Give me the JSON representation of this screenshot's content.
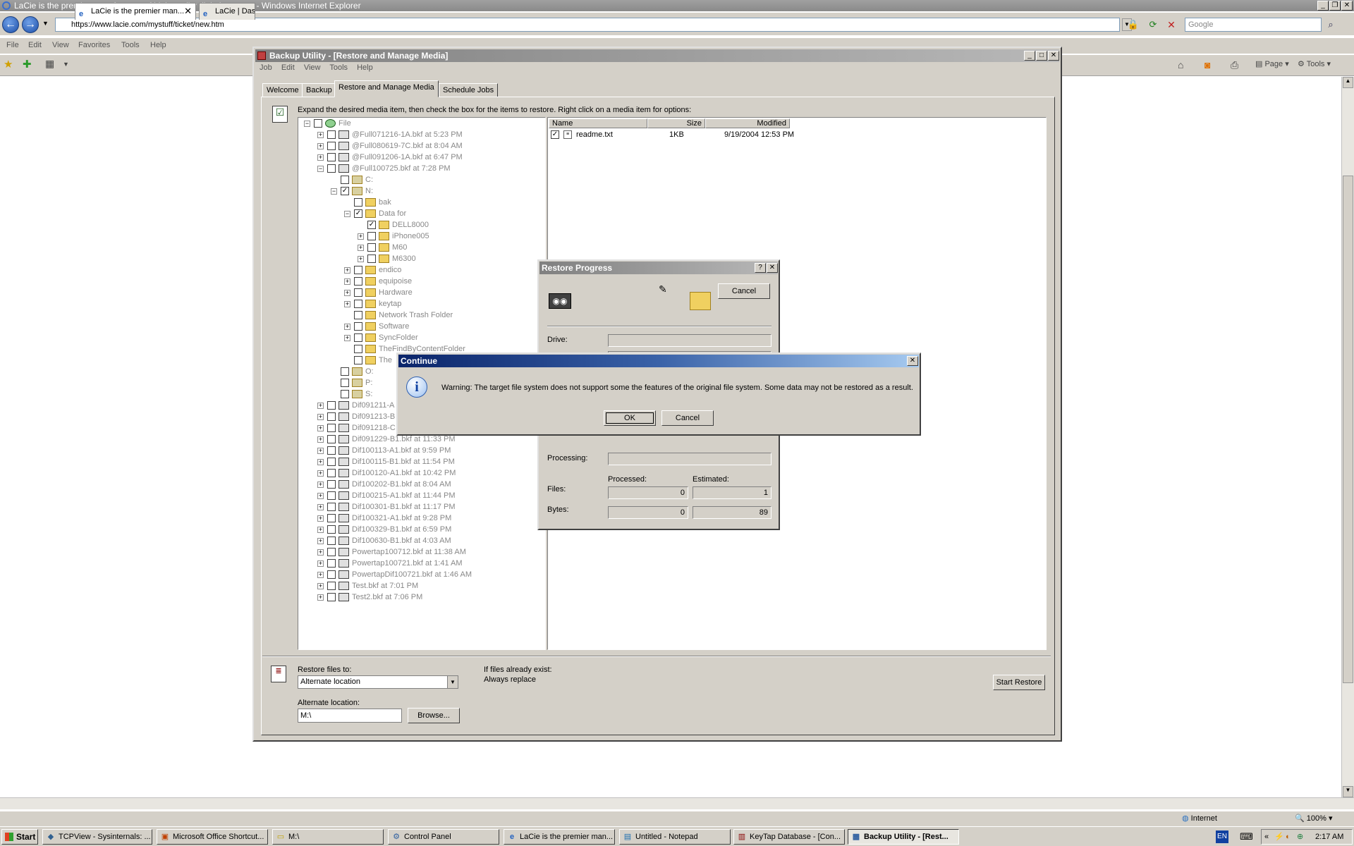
{
  "ie": {
    "title": "LaCie is the premier manufacturer of high quality digital storage. - Windows Internet Explorer",
    "url": "https://www.lacie.com/mystuff/ticket/new.htm",
    "search_placeholder": "Google",
    "menu": [
      "File",
      "Edit",
      "View",
      "Favorites",
      "Tools",
      "Help"
    ],
    "tabs": [
      "LaCie is the premier man...",
      "LaCie | Das"
    ],
    "toolbar": {
      "page": "Page",
      "tools": "Tools"
    },
    "status": {
      "zone": "Internet",
      "zoom": "100%"
    }
  },
  "backup": {
    "title": "Backup Utility - [Restore and Manage Media]",
    "menu": [
      "Job",
      "Edit",
      "View",
      "Tools",
      "Help"
    ],
    "tabs": [
      "Welcome",
      "Backup",
      "Restore and Manage Media",
      "Schedule Jobs"
    ],
    "instruction": "Expand the desired media item, then check the box for the items to restore. Right click on a media item for options:",
    "tree": [
      {
        "label": "File",
        "indent": 0,
        "exp": "-",
        "icon": "file"
      },
      {
        "label": "@Full071216-1A.bkf at 5:23 PM",
        "indent": 1,
        "exp": "+",
        "icon": "tape"
      },
      {
        "label": "@Full080619-7C.bkf at 8:04 AM",
        "indent": 1,
        "exp": "+",
        "icon": "tape"
      },
      {
        "label": "@Full091206-1A.bkf at 6:47 PM",
        "indent": 1,
        "exp": "+",
        "icon": "tape"
      },
      {
        "label": "@Full100725.bkf at 7:28 PM",
        "indent": 1,
        "exp": "-",
        "icon": "tape"
      },
      {
        "label": "C:",
        "indent": 2,
        "exp": "",
        "icon": "drive"
      },
      {
        "label": "N:",
        "indent": 2,
        "exp": "-",
        "icon": "drive",
        "checked": true
      },
      {
        "label": "bak",
        "indent": 3,
        "exp": "",
        "icon": "folder"
      },
      {
        "label": "Data for",
        "indent": 3,
        "exp": "-",
        "icon": "folder",
        "checked": true
      },
      {
        "label": "DELL8000",
        "indent": 4,
        "exp": "",
        "icon": "folder",
        "checked": true
      },
      {
        "label": "iPhone005",
        "indent": 4,
        "exp": "+",
        "icon": "folder"
      },
      {
        "label": "M60",
        "indent": 4,
        "exp": "+",
        "icon": "folder"
      },
      {
        "label": "M6300",
        "indent": 4,
        "exp": "+",
        "icon": "folder"
      },
      {
        "label": "endico",
        "indent": 3,
        "exp": "+",
        "icon": "folder"
      },
      {
        "label": "equipoise",
        "indent": 3,
        "exp": "+",
        "icon": "folder"
      },
      {
        "label": "Hardware",
        "indent": 3,
        "exp": "+",
        "icon": "folder"
      },
      {
        "label": "keytap",
        "indent": 3,
        "exp": "+",
        "icon": "folder"
      },
      {
        "label": "Network Trash Folder",
        "indent": 3,
        "exp": "",
        "icon": "folder"
      },
      {
        "label": "Software",
        "indent": 3,
        "exp": "+",
        "icon": "folder"
      },
      {
        "label": "SyncFolder",
        "indent": 3,
        "exp": "+",
        "icon": "folder"
      },
      {
        "label": "TheFindByContentFolder",
        "indent": 3,
        "exp": "",
        "icon": "folder"
      },
      {
        "label": "The",
        "indent": 3,
        "exp": "",
        "icon": "folder"
      },
      {
        "label": "O:",
        "indent": 2,
        "exp": "",
        "icon": "drive"
      },
      {
        "label": "P:",
        "indent": 2,
        "exp": "",
        "icon": "drive"
      },
      {
        "label": "S:",
        "indent": 2,
        "exp": "",
        "icon": "drive"
      },
      {
        "label": "Dif091211-A",
        "indent": 1,
        "exp": "+",
        "icon": "tape"
      },
      {
        "label": "Dif091213-B",
        "indent": 1,
        "exp": "+",
        "icon": "tape"
      },
      {
        "label": "Dif091218-C",
        "indent": 1,
        "exp": "+",
        "icon": "tape"
      },
      {
        "label": "Dif091229-B1.bkf at 11:33 PM",
        "indent": 1,
        "exp": "+",
        "icon": "tape"
      },
      {
        "label": "Dif100113-A1.bkf at 9:59 PM",
        "indent": 1,
        "exp": "+",
        "icon": "tape"
      },
      {
        "label": "Dif100115-B1.bkf at 11:54 PM",
        "indent": 1,
        "exp": "+",
        "icon": "tape"
      },
      {
        "label": "Dif100120-A1.bkf at 10:42 PM",
        "indent": 1,
        "exp": "+",
        "icon": "tape"
      },
      {
        "label": "Dif100202-B1.bkf at 8:04 AM",
        "indent": 1,
        "exp": "+",
        "icon": "tape"
      },
      {
        "label": "Dif100215-A1.bkf at 11:44 PM",
        "indent": 1,
        "exp": "+",
        "icon": "tape"
      },
      {
        "label": "Dif100301-B1.bkf at 11:17 PM",
        "indent": 1,
        "exp": "+",
        "icon": "tape"
      },
      {
        "label": "Dif100321-A1.bkf at 9:28 PM",
        "indent": 1,
        "exp": "+",
        "icon": "tape"
      },
      {
        "label": "Dif100329-B1.bkf at 6:59 PM",
        "indent": 1,
        "exp": "+",
        "icon": "tape"
      },
      {
        "label": "Dif100630-B1.bkf at 4:03 AM",
        "indent": 1,
        "exp": "+",
        "icon": "tape"
      },
      {
        "label": "Powertap100712.bkf at 11:38 AM",
        "indent": 1,
        "exp": "+",
        "icon": "tape"
      },
      {
        "label": "Powertap100721.bkf at 1:41 AM",
        "indent": 1,
        "exp": "+",
        "icon": "tape"
      },
      {
        "label": "PowertapDif100721.bkf at 1:46 AM",
        "indent": 1,
        "exp": "+",
        "icon": "tape"
      },
      {
        "label": "Test.bkf at 7:01 PM",
        "indent": 1,
        "exp": "+",
        "icon": "tape"
      },
      {
        "label": "Test2.bkf at 7:06 PM",
        "indent": 1,
        "exp": "+",
        "icon": "tape"
      }
    ],
    "files": {
      "headers": [
        "Name",
        "Size",
        "Modified"
      ],
      "rows": [
        {
          "name": "readme.txt",
          "size": "1KB",
          "modified": "9/19/2004 12:53 PM"
        }
      ]
    },
    "restore_to_label": "Restore files to:",
    "restore_to_value": "Alternate location",
    "if_exists_label": "If files already exist:",
    "if_exists_value": "Always replace",
    "alt_location_label": "Alternate location:",
    "alt_location_value": "M:\\",
    "browse": "Browse...",
    "start_restore": "Start Restore"
  },
  "progress": {
    "title": "Restore Progress",
    "cancel": "Cancel",
    "drive": "Drive:",
    "processing": "Processing:",
    "processed": "Processed:",
    "estimated": "Estimated:",
    "files": "Files:",
    "bytes": "Bytes:",
    "files_processed": "0",
    "files_estimated": "1",
    "bytes_processed": "0",
    "bytes_estimated": "89"
  },
  "cont": {
    "title": "Continue",
    "message": "Warning: The target file system does not support some the features of the original file system.  Some data may not be restored as a result.",
    "ok": "OK",
    "cancel": "Cancel"
  },
  "taskbar": {
    "start": "Start",
    "items": [
      "TCPView - Sysinternals: ...",
      "Microsoft Office Shortcut...",
      "M:\\",
      "Control Panel",
      "LaCie is the premier man...",
      "Untitled - Notepad",
      "KeyTap Database - [Con...",
      "Backup Utility - [Rest..."
    ],
    "lang": "EN",
    "time": "2:17 AM"
  }
}
